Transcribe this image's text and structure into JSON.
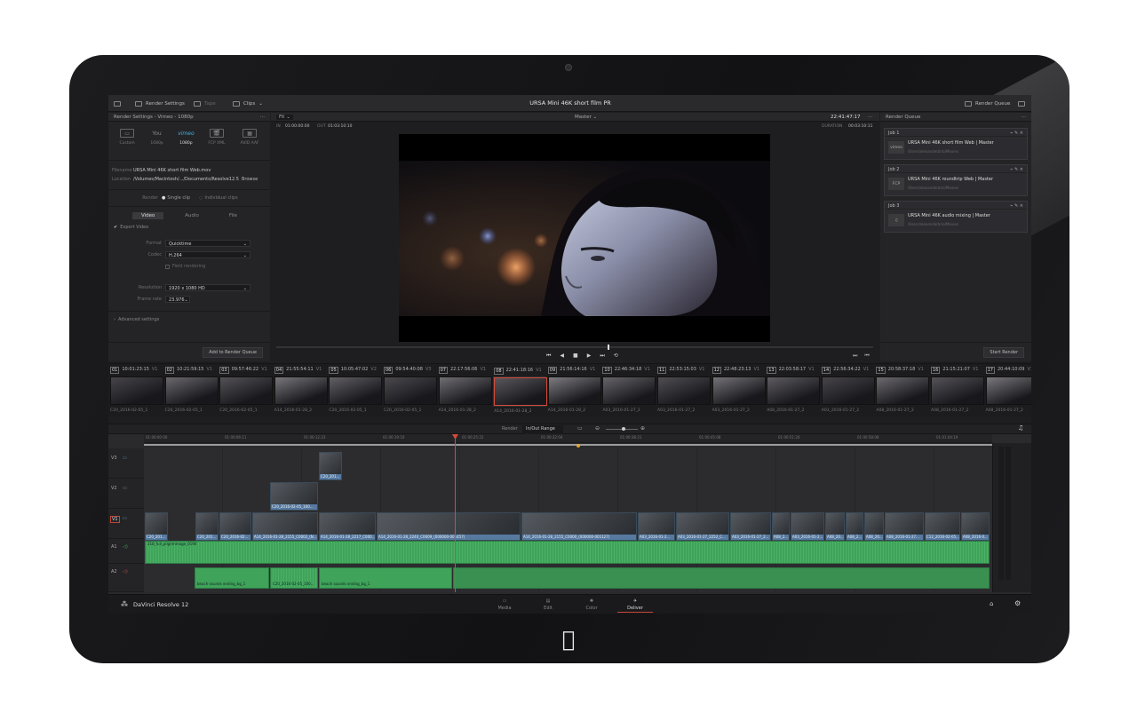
{
  "app": {
    "name": "DaVinci Resolve 12",
    "project_title": "URSA Mini 46K short film PR"
  },
  "topbar": {
    "render_settings_label": "Render Settings",
    "tape_label": "Tape",
    "clips_label": "Clips",
    "render_queue_label": "Render Queue"
  },
  "render_settings": {
    "header": "Render Settings - Vimeo - 1080p",
    "presets": [
      {
        "icon": "custom-preset-icon",
        "label": "Custom"
      },
      {
        "icon": "youtube-preset-icon",
        "label": "1080p"
      },
      {
        "icon": "vimeo-preset-icon",
        "label": "1080p"
      },
      {
        "icon": "final-cut-preset-icon",
        "label": "FCP XML"
      },
      {
        "icon": "avid-preset-icon",
        "label": "AVID AAF"
      }
    ],
    "filename_label": "Filename",
    "filename": "URSA Mini 46K short film Web.mov",
    "location_label": "Location",
    "location": "/Volumes/Macintosh/.../Documents/Resolve12.5",
    "browse_label": "Browse",
    "render_label": "Render",
    "single_clip": "Single clip",
    "individual_clips": "Individual clips",
    "tabs": [
      "Video",
      "Audio",
      "File"
    ],
    "export_video_label": "Export Video",
    "format_label": "Format",
    "format": "Quicktime",
    "codec_label": "Codec",
    "codec": "H.264",
    "field_rendering": "Field rendering",
    "resolution_label": "Resolution",
    "resolution": "1920 x 1080 HD",
    "frame_rate_label": "Frame rate",
    "frame_rate": "23.976",
    "advanced_settings": "Advanced settings",
    "add_to_queue": "Add to Render Queue"
  },
  "viewer": {
    "fit_label": "Fit",
    "master_label": "Master",
    "timecode": "22:41:47:17",
    "in_label": "IN",
    "in_tc": "01:00:00:00",
    "out_label": "OUT",
    "out_tc": "01:03:10:10",
    "duration_label": "DURATION",
    "duration_tc": "00:03:10:11"
  },
  "render_queue": {
    "header": "Render Queue",
    "jobs": [
      {
        "id": "Job 1",
        "title": "URSA Mini 46K short film Web | Master",
        "path": "/Users/alexanderbrio/Movies",
        "thumb": "vimeo"
      },
      {
        "id": "Job 2",
        "title": "URSA Mini 46K roundtrip Web | Master",
        "path": "/Users/alexanderbrio/Movies",
        "thumb": "FCP"
      },
      {
        "id": "Job 3",
        "title": "URSA Mini 46K audio mixing | Master",
        "path": "/Users/alexanderbrio/Movies",
        "thumb": "♫"
      }
    ],
    "start_render": "Start Render"
  },
  "clips": [
    {
      "n": "01",
      "tc": "10:01:23:15",
      "t": "V1",
      "name": "C20_2016-02-05_1"
    },
    {
      "n": "02",
      "tc": "10:21:59:15",
      "t": "V1",
      "name": "C20_2016-02-05_1"
    },
    {
      "n": "03",
      "tc": "09:57:46:22",
      "t": "V1",
      "name": "C20_2016-02-05_1"
    },
    {
      "n": "04",
      "tc": "21:55:54:11",
      "t": "V1",
      "name": "A14_2016-01-28_2"
    },
    {
      "n": "05",
      "tc": "10:05:47:02",
      "t": "V2",
      "name": "C20_2016-02-05_1"
    },
    {
      "n": "06",
      "tc": "09:54:40:08",
      "t": "V3",
      "name": "C20_2016-02-05_1"
    },
    {
      "n": "07",
      "tc": "22:17:56:06",
      "t": "V1",
      "name": "A14_2016-01-28_2"
    },
    {
      "n": "08",
      "tc": "22:41:18:16",
      "t": "V1",
      "name": "A14_2016-01-28_2"
    },
    {
      "n": "09",
      "tc": "21:56:14:16",
      "t": "V1",
      "name": "A14_2016-01-28_2"
    },
    {
      "n": "10",
      "tc": "22:46:34:18",
      "t": "V1",
      "name": "A03_2016-01-27_2"
    },
    {
      "n": "11",
      "tc": "22:53:15:03",
      "t": "V1",
      "name": "A03_2016-01-27_2"
    },
    {
      "n": "12",
      "tc": "22:48:23:13",
      "t": "V1",
      "name": "A03_2016-01-27_2"
    },
    {
      "n": "13",
      "tc": "22:03:58:17",
      "t": "V1",
      "name": "A08_2016-01-27_2"
    },
    {
      "n": "14",
      "tc": "22:56:34:22",
      "t": "V1",
      "name": "A03_2016-01-27_2"
    },
    {
      "n": "15",
      "tc": "20:58:37:18",
      "t": "V1",
      "name": "A08_2016-01-27_2"
    },
    {
      "n": "16",
      "tc": "21:15:21:07",
      "t": "V1",
      "name": "A08_2016-01-27_2"
    },
    {
      "n": "17",
      "tc": "20:44:10:09",
      "t": "V1",
      "name": "A08_2016-01-27_2"
    }
  ],
  "timeline": {
    "render_label": "Render",
    "range_option": "In/Out Range",
    "ruler": [
      "01:00:00:00",
      "01:00:06:11",
      "01:00:12:23",
      "01:00:19:10",
      "01:00:25:22",
      "01:00:32:04",
      "01:00:38:21",
      "01:00:45:08",
      "01:00:51:20",
      "01:00:58:08",
      "01:01:04:19"
    ],
    "tracks": [
      "V3",
      "V2",
      "V1",
      "A1",
      "A2"
    ],
    "v3_clip": "C20_201...",
    "v2_clip": "C20_2016-02-05_100...",
    "v1_clips": [
      "C20_201...",
      "C20_201...",
      "C20_2016-02...",
      "A14_2016-01-28_2155_C0002_(N...",
      "A14_2016-01-28_2217_C000...",
      "A14_2016-01-28_2240_C0009_(000000-001457)",
      "A14_2016-01-28_2155_C0000_(000000-001127)",
      "A03_2016-01-2...",
      "A03_2016-01-27_2252_C...",
      "A03_2016-01-27_2...",
      "A08_2...",
      "A03_2016-01-2...",
      "A08_20...",
      "A08_2...",
      "A08_20...",
      "A08_2016-01-27...",
      "C12_2016-02-05...",
      "A08_2016-0..."
    ],
    "a1_clip": "218_full_pilgrimmage_0190",
    "a2_clips": [
      "beach sounds ending_bg_1",
      "C20_2016-02-05_100...",
      "beach sounds ending_bg_1"
    ]
  },
  "pages": [
    "Media",
    "Edit",
    "Color",
    "Deliver"
  ],
  "active_page": "Deliver",
  "colors": {
    "accent": "#c0473a",
    "video_clip": "#6f8ea6",
    "audio_clip": "#3fa35a"
  }
}
